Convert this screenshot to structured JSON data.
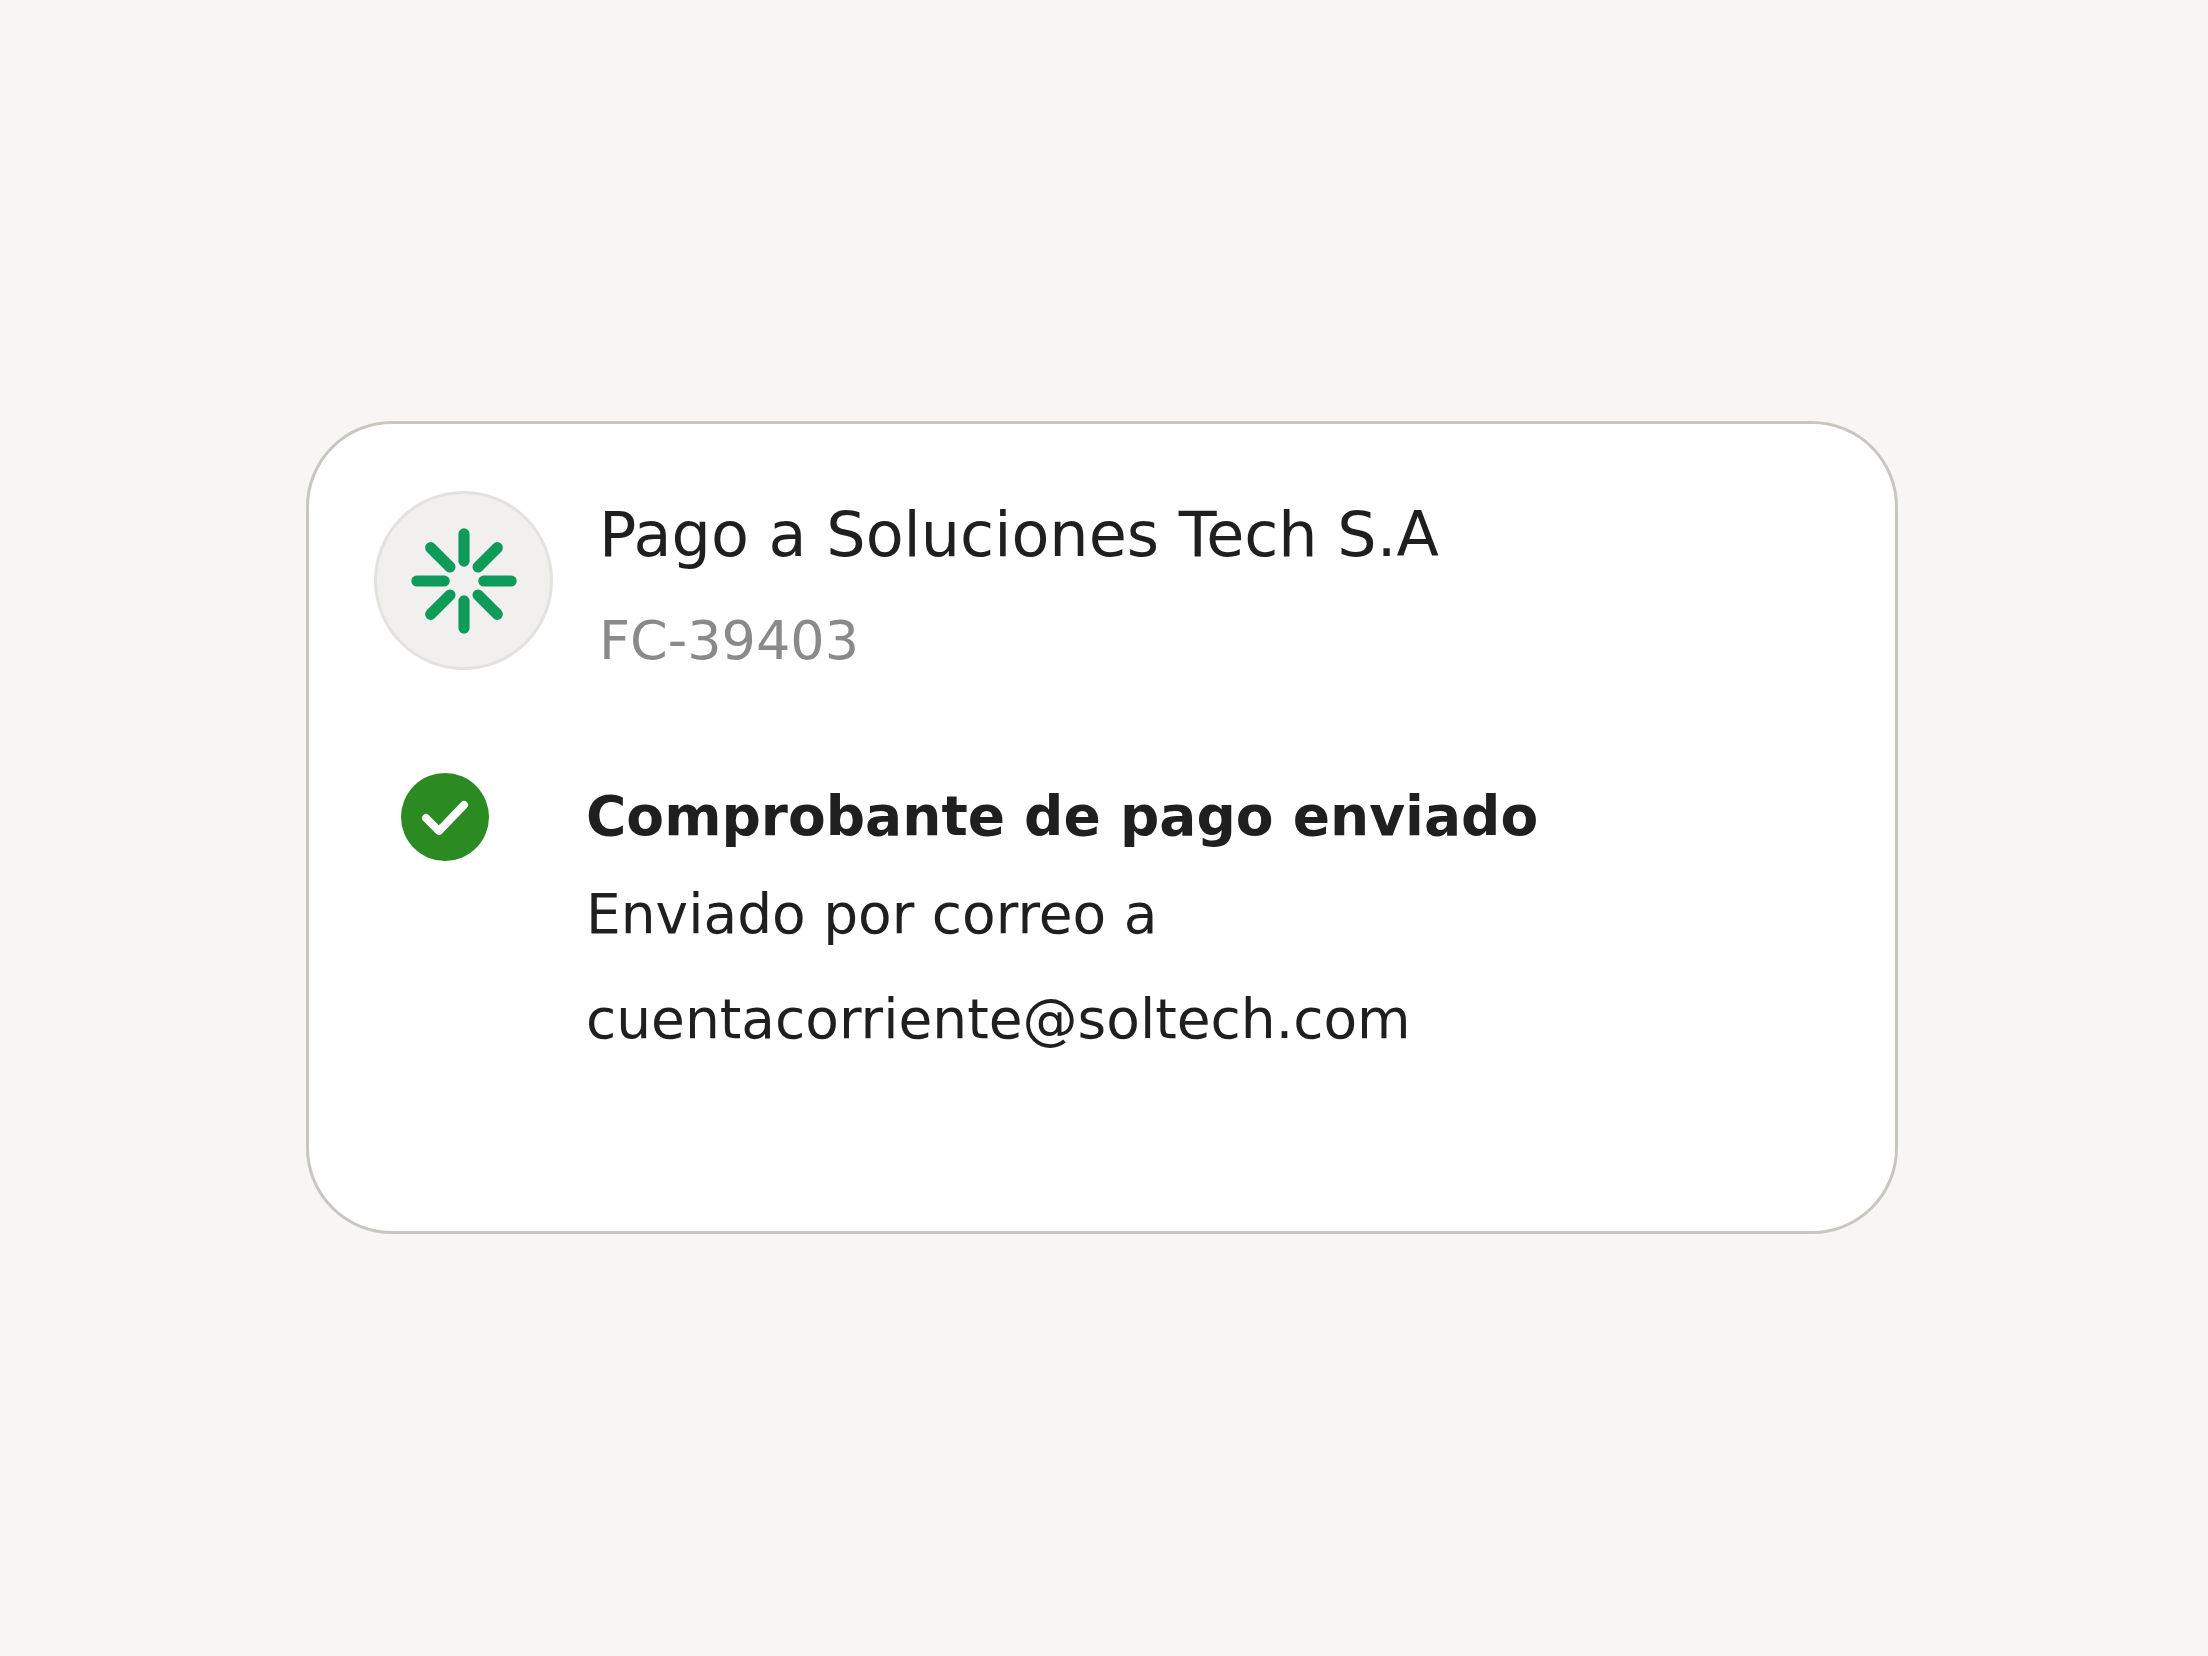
{
  "payment": {
    "title": "Pago a Soluciones Tech S.A",
    "reference": "FC-39403"
  },
  "receipt": {
    "heading": "Comprobante de pago enviado",
    "lines": [
      "Enviado por correo a",
      "cuentacorriente@soltech.com"
    ]
  }
}
